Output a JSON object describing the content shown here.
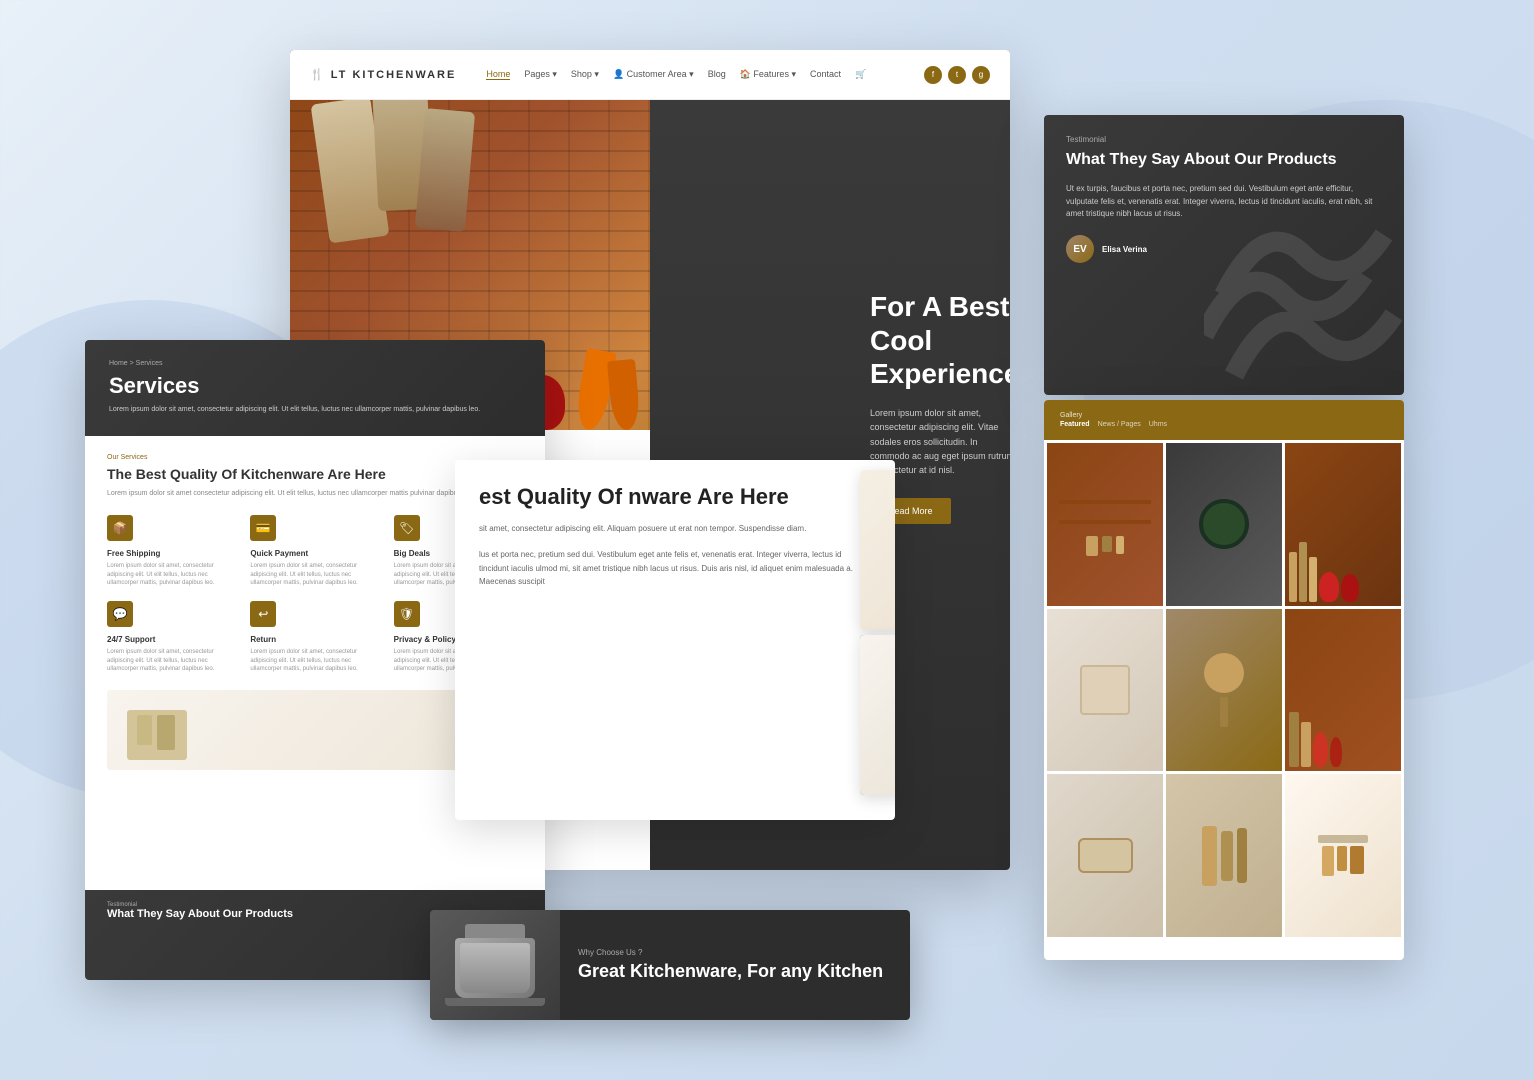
{
  "background": {
    "color": "#dde8f4"
  },
  "brand": {
    "name": "LT KITCHENWARE",
    "prefix": "LT",
    "suffix": "KITCHENWARE"
  },
  "nav": {
    "links": [
      "Home",
      "Pages",
      "Shop",
      "Customer Area",
      "Blog",
      "Features",
      "Contact"
    ],
    "active": "Home",
    "social": [
      "f",
      "t",
      "g"
    ]
  },
  "hero": {
    "headline": "For A Best Cool Experience",
    "subtext": "Lorem ipsum dolor sit amet, consectetur adipiscing elit. Vitae sodales eros sollicitudin. In commodo ac aug eget ipsum rutrum consectetur at id nisl.",
    "cta_label": "Read More"
  },
  "testimonial": {
    "label": "Testimonial",
    "title": "What They Say About Our Products",
    "body": "Ut ex turpis, faucibus et porta nec, pretium sed dui. Vestibulum eget ante efficitur, vulputate felis et, venenatis erat. Integer viverra, lectus id tincidunt iaculis, erat nibh, sit amet tristique nibh lacus ut risus.",
    "author_name": "Elisa Verina"
  },
  "services": {
    "breadcrumb": "Home > Services",
    "page_title": "Services",
    "page_desc": "Lorem ipsum dolor sit amet, consectetur adipiscing elit. Ut elit tellus, luctus nec ullamcorper mattis, pulvinar dapibus leo.",
    "section_label": "Our Services",
    "section_title": "The Best Quality Of Kitchenware Are Here",
    "section_desc": "Lorem ipsum dolor sit amet consectetur adipiscing elit. Ut elit tellus, luctus nec ullamcorper mattis pulvinar dapibus leo.",
    "items": [
      {
        "icon": "📦",
        "name": "Free Shipping",
        "desc": "Lorem ipsum dolor sit amet, consectetur adipiscing elit. Ut elit tellus, luctus nec ullamcorper mattis, pulvinar dapibus leo."
      },
      {
        "icon": "💳",
        "name": "Quick Payment",
        "desc": "Lorem ipsum dolor sit amet, consectetur adipiscing elit. Ut elit tellus, luctus nec ullamcorper mattis, pulvinar dapibus leo."
      },
      {
        "icon": "🏷",
        "name": "Big Deals",
        "desc": "Lorem ipsum dolor sit amet, consectetur adipiscing elit. Ut elit tellus, luctus nec ullamcorper mattis, pulvinar dapibus leo."
      },
      {
        "icon": "💬",
        "name": "24/7 Support",
        "desc": "Lorem ipsum dolor sit amet, consectetur adipiscing elit. Ut elit tellus, luctus nec ullamcorper mattis, pulvinar dapibus leo."
      },
      {
        "icon": "↩",
        "name": "Return",
        "desc": "Lorem ipsum dolor sit amet, consectetur adipiscing elit. Ut elit tellus, luctus nec ullamcorper mattis, pulvinar dapibus leo."
      },
      {
        "icon": "🛡",
        "name": "Privacy & Policy",
        "desc": "Lorem ipsum dolor sit amet, consectetur adipiscing elit. Ut elit tellus, luctus nec ullamcorper mattis, pulvinar dapibus leo."
      }
    ],
    "testimonial_snippet": {
      "label": "Testimonial",
      "title": "What They Say About Our Products"
    }
  },
  "gallery": {
    "label": "Gallery",
    "nav": [
      "Featured",
      "News / Pages",
      "Uhms"
    ],
    "active_nav": "Featured",
    "cells": 9
  },
  "quality": {
    "title": "est Quality Of nware Are Here",
    "body_1": "sit amet, consectetur adipiscing elit. Aliquam posuere ut erat non tempor. Suspendisse diam.",
    "body_2": "lus et porta nec, pretium sed dui. Vestibulum eget ante felis et, venenatis erat. Integer viverra, lectus id tincidunt iaculis ulmod mi, sit amet tristique nibh lacus ut risus. Duis aris nisl, id aliquet enim malesuada a. Maecenas suscipit"
  },
  "promo": {
    "subtitle": "Why Choose Us ?",
    "title": "Great Kitchenware, For any Kitchen"
  }
}
